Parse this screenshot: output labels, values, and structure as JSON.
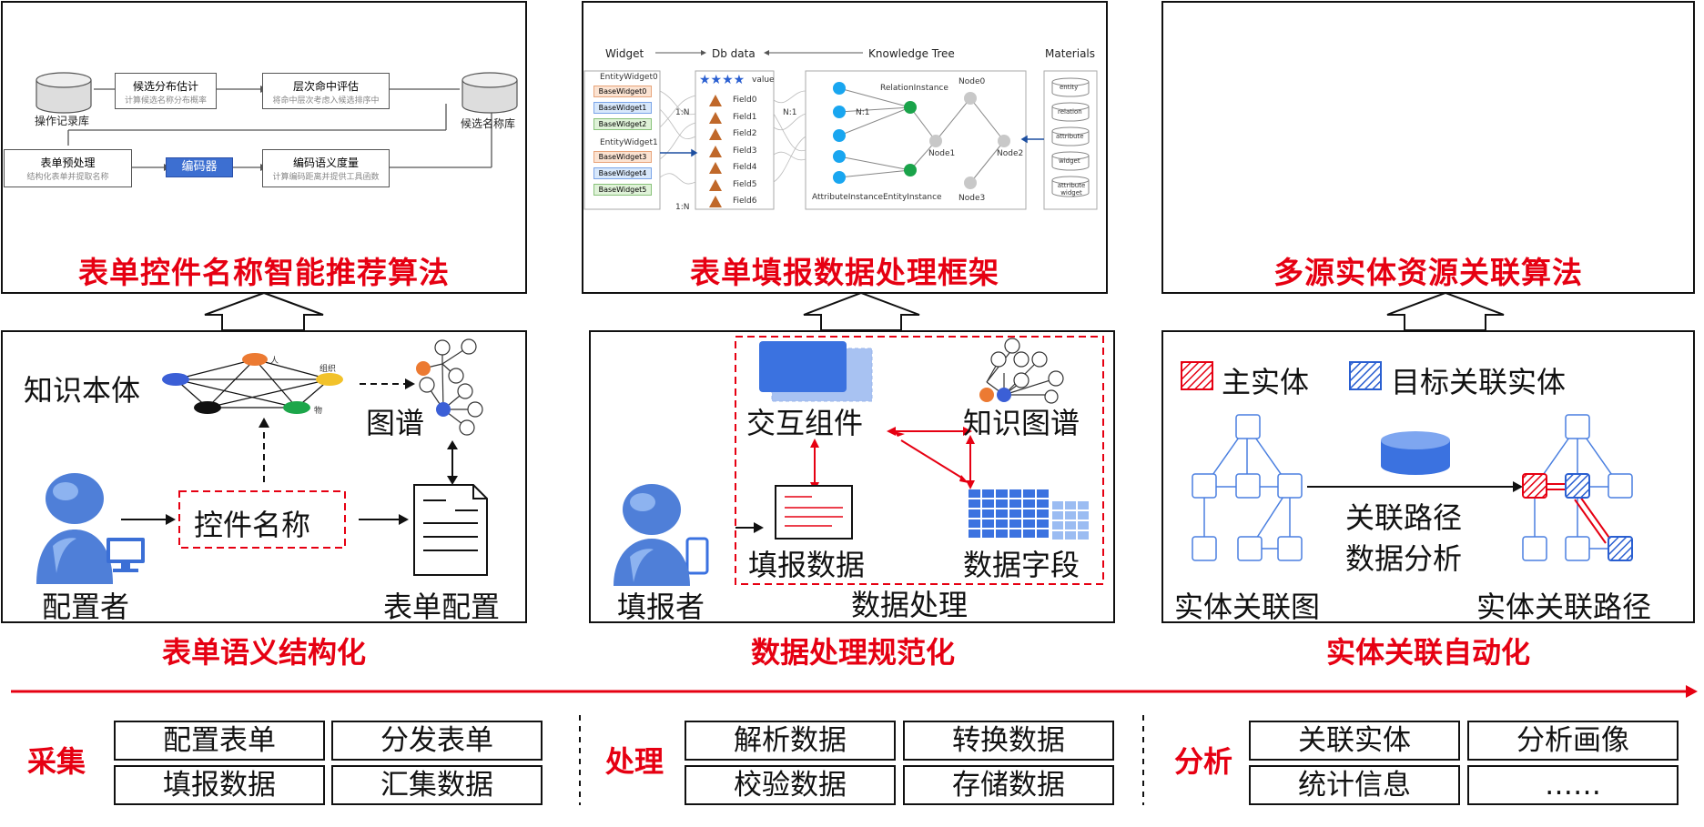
{
  "panels": {
    "top_left_title": "表单控件名称智能推荐算法",
    "top_mid_title": "表单填报数据处理框架",
    "top_right_title": "多源实体资源关联算法",
    "bottom_left_label": "表单语义结构化",
    "bottom_mid_label": "数据处理规范化",
    "bottom_right_label": "实体关联自动化"
  },
  "algo_flow": {
    "db_left": "操作记录库",
    "db_right": "候选名称库",
    "box1_title": "候选分布估计",
    "box1_sub": "计算候选名称分布概率",
    "box2_title": "层次命中评估",
    "box2_sub": "将命中层次考虑入候选排序中",
    "box3_title": "表单预处理",
    "box3_sub": "结构化表单并提取名称",
    "encoder": "编码器",
    "box4_title": "编码语义度量",
    "box4_sub": "计算编码距离并提供工具函数"
  },
  "framework": {
    "h_widget": "Widget",
    "h_db": "Db data",
    "h_tree": "Knowledge Tree",
    "h_materials": "Materials",
    "entity_widget0": "EntityWidget0",
    "entity_widget1": "EntityWidget1",
    "base_widgets": [
      "BaseWidget0",
      "BaseWidget1",
      "BaseWidget2",
      "BaseWidget3",
      "BaseWidget4",
      "BaseWidget5"
    ],
    "value_label": "value",
    "fields": [
      "Field0",
      "Field1",
      "Field2",
      "Field3",
      "Field4",
      "Field5",
      "Field6"
    ],
    "rel_1n_a": "1:N",
    "rel_n1_a": "N:1",
    "rel_n1_b": "N:1",
    "rel_1n_b": "1:N",
    "relation_instance": "RelationInstance",
    "attribute_instance": "AttributeInstance",
    "entity_instance": "EntityInstance",
    "nodes": [
      "Node0",
      "Node1",
      "Node2",
      "Node3"
    ],
    "materials": [
      "entity",
      "relation",
      "attribute",
      "widget",
      "attribute widget"
    ]
  },
  "semantic": {
    "ontology": "知识本体",
    "graph": "图谱",
    "node_labels": [
      "人",
      "组织",
      "物"
    ],
    "widget_name": "控件名称",
    "configurer": "配置者",
    "form_config": "表单配置"
  },
  "processing": {
    "interactive": "交互组件",
    "knowledge_graph": "知识图谱",
    "fill_data": "填报数据",
    "data_fields": "数据字段",
    "data_processing": "数据处理",
    "filler": "填报者"
  },
  "association": {
    "legend_main": "主实体",
    "legend_target": "目标关联实体",
    "path_line1": "关联路径",
    "path_line2": "数据分析",
    "graph_label": "实体关联图",
    "path_label": "实体关联路径"
  },
  "stages": {
    "collect": "采集",
    "collect_items": [
      "配置表单",
      "分发表单",
      "填报数据",
      "汇集数据"
    ],
    "process": "处理",
    "process_items": [
      "解析数据",
      "转换数据",
      "校验数据",
      "存储数据"
    ],
    "analyze": "分析",
    "analyze_items": [
      "关联实体",
      "分析画像",
      "统计信息",
      "……"
    ]
  },
  "colors": {
    "accent_red": "#e60012",
    "node_blue": "#4a7fe0"
  }
}
